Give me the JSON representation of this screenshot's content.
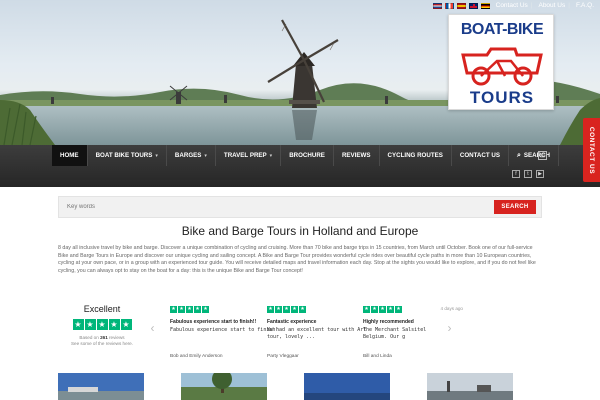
{
  "header": {
    "languages": [
      "nl",
      "fr",
      "es",
      "gb",
      "de"
    ],
    "language_icons": [
      "flag-netherlands-icon",
      "flag-france-icon",
      "flag-spain-icon",
      "flag-uk-icon",
      "flag-germany-icon"
    ],
    "links": [
      "Contact Us",
      "About Us",
      "F.A.Q."
    ],
    "separator": "|"
  },
  "logo": {
    "line1": "BOAT-BIKE",
    "line2": "TOURS",
    "primary_color": "#1a3c8a",
    "accent_color": "#d7231f"
  },
  "contact_tab": {
    "label": "CONTACT US"
  },
  "nav": {
    "items": [
      {
        "label": "HOME",
        "active": true,
        "dropdown": false
      },
      {
        "label": "BOAT BIKE TOURS",
        "active": false,
        "dropdown": true
      },
      {
        "label": "BARGES",
        "active": false,
        "dropdown": true
      },
      {
        "label": "TRAVEL PREP",
        "active": false,
        "dropdown": true
      },
      {
        "label": "BROCHURE",
        "active": false,
        "dropdown": false
      },
      {
        "label": "REVIEWS",
        "active": false,
        "dropdown": false
      },
      {
        "label": "CYCLING ROUTES",
        "active": false,
        "dropdown": false
      },
      {
        "label": "CONTACT US",
        "active": false,
        "dropdown": false
      },
      {
        "label": "SEARCH",
        "active": false,
        "dropdown": false
      }
    ],
    "caret": "▾",
    "search_icon": "⌕",
    "square_icon": "▤",
    "social_icons": [
      "facebook-icon",
      "twitter-icon",
      "youtube-icon"
    ],
    "social_glyphs": [
      "f",
      "t",
      "▶"
    ]
  },
  "search": {
    "placeholder": "Key words",
    "button_label": "SEARCH"
  },
  "main": {
    "title": "Bike and Barge Tours in Holland and Europe",
    "intro": "8 day all inclusive travel by bike and barge. Discover a unique combination of cycling and cruising. More than 70 bike and barge trips in 15 countries, from March until October. Book one of our full-service Bike and Barge Tours in Europe and discover our unique cycling and sailing concept. A Bike and Barge Tour provides wonderful cycle rides over beautiful cycle paths in more than 10 European countries, cycling at your own pace, or in a group with an experienced tour guide. You will receive detailed maps and travel information each day. Stop at the sights you would like to explore, and if you do not feel like cycling, you can always opt to stay on the boat for a day: this is the unique Bike and Barge Tour concept!"
  },
  "reviews": {
    "summary_label": "Excellent",
    "rating": 5,
    "star_glyph": "★",
    "based_on_prefix": "Based on",
    "count": "261",
    "count_suffix": "reviews",
    "see_some": "See some of the reviews here.",
    "brand_color": "#00b67a",
    "prev_glyph": "‹",
    "next_glyph": "›",
    "items": [
      {
        "title": "Fabulous experience start to finish!!",
        "text": "Fabulous experience start to finish!",
        "author": "Bob and Emily Anderson",
        "date": ""
      },
      {
        "title": "Fantastic experience",
        "text": "We had an excellent tour with Art\ntour, lovely ...",
        "author": "Party Vleggaar",
        "date": ""
      },
      {
        "title": "Highly recommended",
        "text": "The Merchant Salsitel\nBelgium. Our g",
        "author": "Bill and Linda",
        "date": "4 days ago"
      }
    ]
  }
}
